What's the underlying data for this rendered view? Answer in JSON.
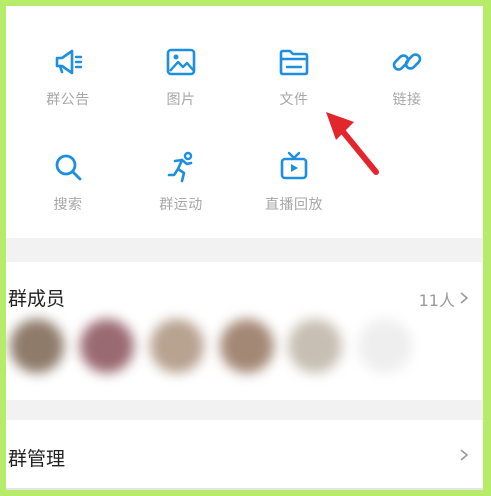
{
  "grid": {
    "row1": [
      {
        "label": "群公告",
        "icon": "megaphone-icon"
      },
      {
        "label": "图片",
        "icon": "image-icon"
      },
      {
        "label": "文件",
        "icon": "folder-icon"
      },
      {
        "label": "链接",
        "icon": "link-icon"
      }
    ],
    "row2": [
      {
        "label": "搜索",
        "icon": "search-icon"
      },
      {
        "label": "群运动",
        "icon": "running-icon"
      },
      {
        "label": "直播回放",
        "icon": "tv-icon"
      }
    ]
  },
  "members": {
    "title": "群成员",
    "count": "11人"
  },
  "manage": {
    "title": "群管理"
  },
  "colors": {
    "accent": "#1d8fe0",
    "label": "#a7a7a7",
    "arrow": "#e3262c",
    "frame": "#b6ec6a"
  }
}
